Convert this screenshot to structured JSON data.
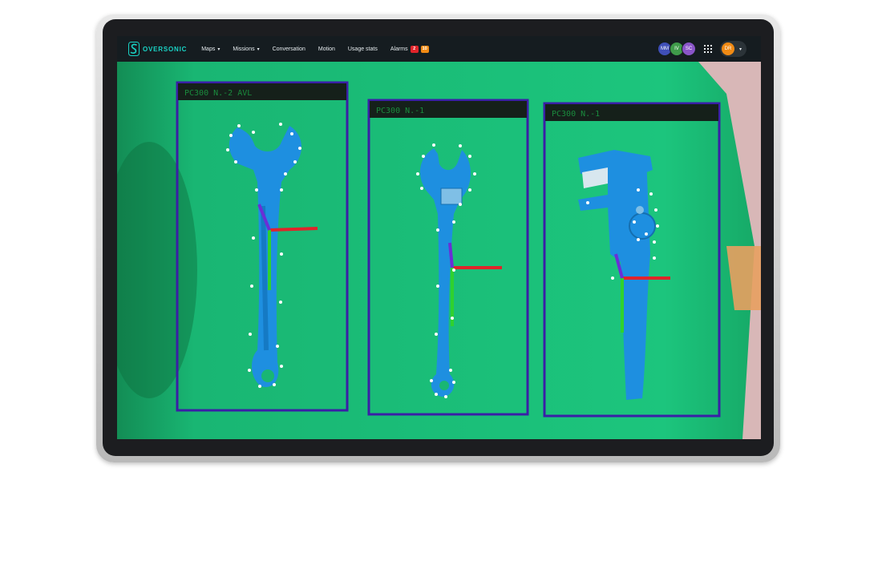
{
  "app": {
    "brand": "OVERSONIC"
  },
  "nav": {
    "items": [
      {
        "label": "Maps",
        "dropdown": true
      },
      {
        "label": "Missions",
        "dropdown": true
      },
      {
        "label": "Conversation",
        "dropdown": false
      },
      {
        "label": "Motion",
        "dropdown": false
      },
      {
        "label": "Usage stats",
        "dropdown": false
      },
      {
        "label": "Alarms",
        "dropdown": false
      }
    ],
    "alarm_badges": [
      {
        "value": "2",
        "color": "#e0242a"
      },
      {
        "value": "10",
        "color": "#f08a14"
      }
    ]
  },
  "users": {
    "avatars": [
      {
        "initials": "MM",
        "color": "#3f4fb8"
      },
      {
        "initials": "IV",
        "color": "#3f9b4a"
      },
      {
        "initials": "SC",
        "color": "#8a55c8"
      }
    ],
    "current": {
      "initials": "DR",
      "color": "#f08a14"
    }
  },
  "detections": [
    {
      "label": "PC300  N.-2  AVL",
      "object": "adjustable wrench"
    },
    {
      "label": "PC300  N.-1",
      "object": "small adjustable wrench"
    },
    {
      "label": "PC300  N.-1",
      "object": "pipe wrench"
    }
  ],
  "colors": {
    "accent": "#19d3c5",
    "background_screen": "#19b673",
    "bounding_box": "#3a1fa6",
    "tool": "#1e8fe0",
    "axis_x": "#e0242a",
    "axis_y": "#2fd12f",
    "axis_z": "#6a2fd6"
  }
}
